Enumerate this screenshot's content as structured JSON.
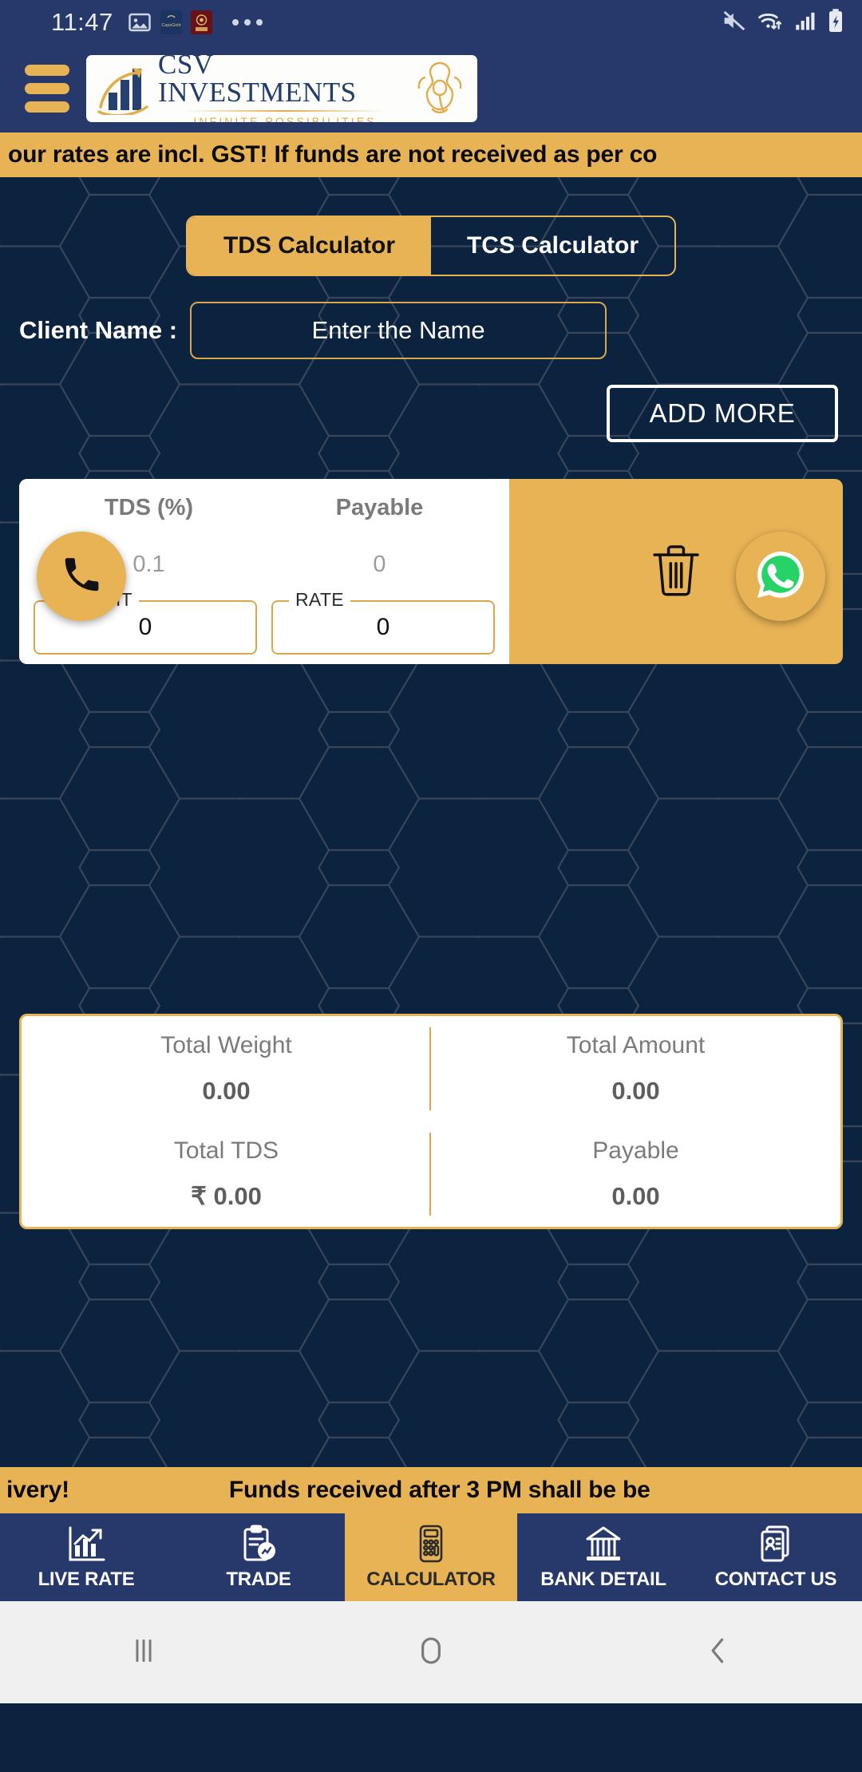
{
  "status_bar": {
    "time": "11:47",
    "left_icons": [
      "image-icon",
      "app-capsgold-icon",
      "app-badge-icon",
      "more-dots-icon"
    ],
    "right_icons": [
      "mute-icon",
      "wifi-icon",
      "signal-icon",
      "battery-charging-icon"
    ]
  },
  "header": {
    "menu_icon": "hamburger-icon",
    "logo": {
      "title": "CSV INVESTMENTS",
      "tagline": "INFINITE POSSIBILITIES"
    }
  },
  "marquee_top": {
    "text": "our rates are incl. GST! If funds are not received as per co"
  },
  "marquee_bottom": {
    "text_a": "ivery!",
    "text_b": "Funds received after 3 PM shall be be"
  },
  "tabs": [
    {
      "label": "TDS Calculator",
      "active": true
    },
    {
      "label": "TCS Calculator",
      "active": false
    }
  ],
  "client": {
    "label": "Client Name :",
    "placeholder": "Enter the Name",
    "value": ""
  },
  "add_more": {
    "label": "ADD MORE"
  },
  "entry_row": {
    "tds_percent_label": "TDS (%)",
    "tds_percent_value": "0.1",
    "payable_label": "Payable",
    "payable_value": "0",
    "weight_label": "WEIGHT",
    "weight_value": "0",
    "rate_label": "RATE",
    "rate_value": "0",
    "delete_icon": "trash-icon"
  },
  "totals": [
    {
      "label": "Total Weight",
      "value": "0.00"
    },
    {
      "label": "Total Amount",
      "value": "0.00"
    },
    {
      "label": "Total TDS",
      "value": "₹ 0.00"
    },
    {
      "label": "Payable",
      "value": "0.00"
    }
  ],
  "fabs": [
    {
      "name": "call-fab",
      "icon": "phone-icon"
    },
    {
      "name": "whatsapp-fab",
      "icon": "whatsapp-icon"
    }
  ],
  "bottom_nav": [
    {
      "label": "LIVE RATE",
      "icon": "chart-growth-icon",
      "active": false
    },
    {
      "label": "TRADE",
      "icon": "clipboard-chart-icon",
      "active": false
    },
    {
      "label": "CALCULATOR",
      "icon": "calculator-icon",
      "active": true
    },
    {
      "label": "BANK DETAIL",
      "icon": "bank-icon",
      "active": false
    },
    {
      "label": "CONTACT US",
      "icon": "contact-card-icon",
      "active": false
    }
  ],
  "android_nav": [
    {
      "name": "recents-button",
      "icon": "recents-icon"
    },
    {
      "name": "home-button",
      "icon": "home-circle-icon"
    },
    {
      "name": "back-button",
      "icon": "back-chevron-icon"
    }
  ],
  "colors": {
    "gold": "#e8b355",
    "navy_header": "#27386b",
    "navy_bg": "#0c2340",
    "white": "#ffffff",
    "whatsapp_green": "#25D366"
  }
}
